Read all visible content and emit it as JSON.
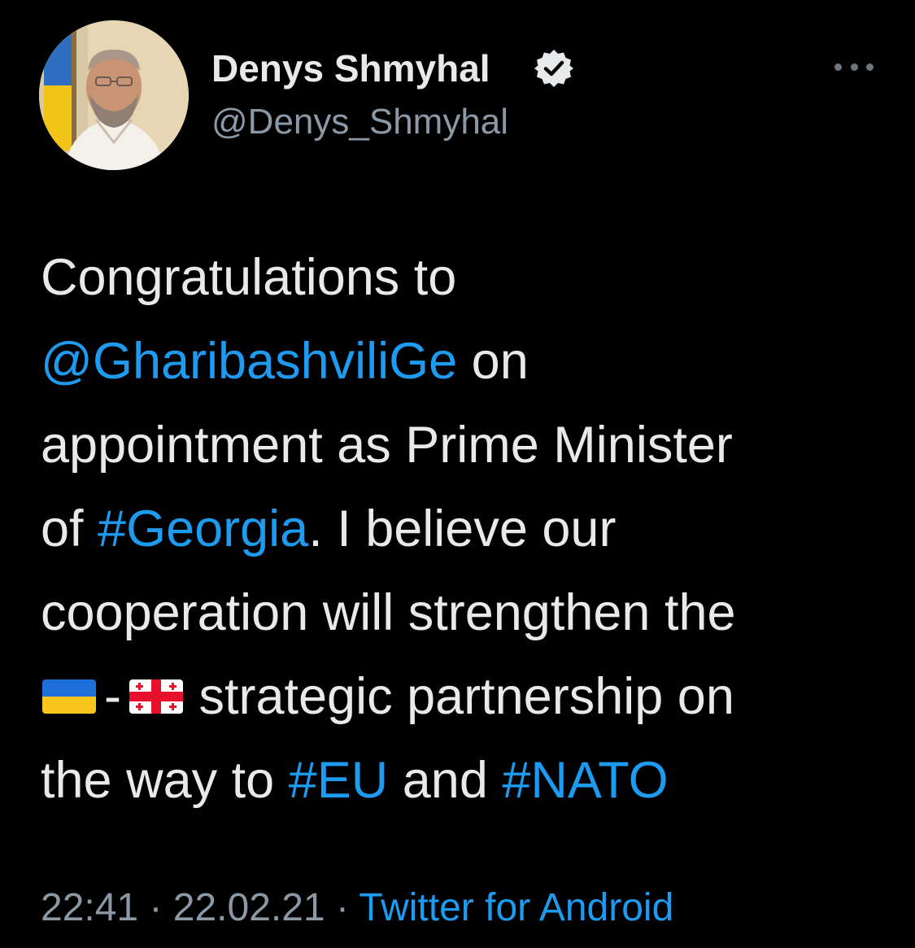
{
  "author": {
    "display_name": "Denys Shmyhal",
    "handle": "@Denys_Shmyhal",
    "verified": true
  },
  "more_icon": "more-horizontal-icon",
  "tweet": {
    "line1": "Congratulations to",
    "mention": "@GharibashviliGe",
    "line2_rest": " on",
    "line3": "appointment as Prime Minister",
    "line4_pre": "of ",
    "hashtag_georgia": "#Georgia",
    "line4_rest": ". I believe our",
    "line5": "cooperation will strengthen the",
    "flag_ua": "ukraine-flag-emoji",
    "dash": "-",
    "flag_ge": "georgia-flag-emoji",
    "line6_rest": " strategic partnership on",
    "line7_pre": "the way to ",
    "hashtag_eu": "#EU",
    "line7_mid": " and ",
    "hashtag_nato": "#NATO"
  },
  "meta": {
    "time": "22:41",
    "sep1": " · ",
    "date": "22.02.21",
    "sep2": " · ",
    "source": "Twitter for Android"
  },
  "colors": {
    "background": "#000000",
    "text": "#E7E9EA",
    "secondary": "#8B98A5",
    "link": "#1D9BF0"
  }
}
